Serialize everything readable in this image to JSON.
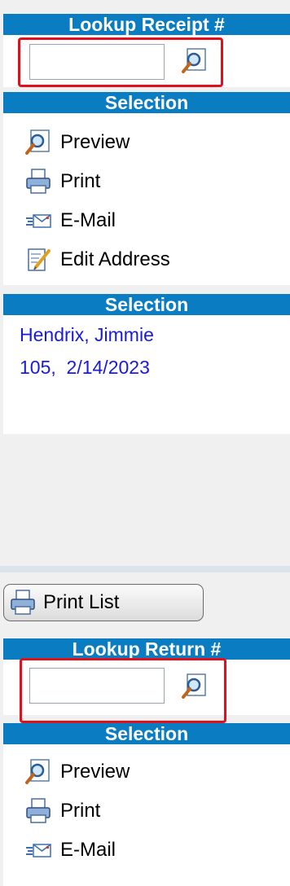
{
  "receipt_lookup": {
    "title": "Lookup Receipt #",
    "input_value": ""
  },
  "selection_1": {
    "title": "Selection",
    "items": [
      {
        "label": "Preview",
        "icon": "preview-icon"
      },
      {
        "label": "Print",
        "icon": "print-icon"
      },
      {
        "label": "E-Mail",
        "icon": "email-icon"
      },
      {
        "label": "Edit Address",
        "icon": "edit-address-icon"
      }
    ]
  },
  "selection_2": {
    "title": "Selection",
    "customer_name": "Hendrix, Jimmie",
    "receipt_info": "105,  2/14/2023"
  },
  "print_list_button": {
    "label": "Print List"
  },
  "return_lookup": {
    "title": "Lookup Return #",
    "input_value": ""
  },
  "selection_3": {
    "title": "Selection",
    "items": [
      {
        "label": "Preview",
        "icon": "preview-icon"
      },
      {
        "label": "Print",
        "icon": "print-icon"
      },
      {
        "label": "E-Mail",
        "icon": "email-icon"
      }
    ]
  },
  "colors": {
    "header_bg": "#0a7cc2",
    "highlight_border": "#e0101c",
    "link_text": "#1a1adf"
  }
}
